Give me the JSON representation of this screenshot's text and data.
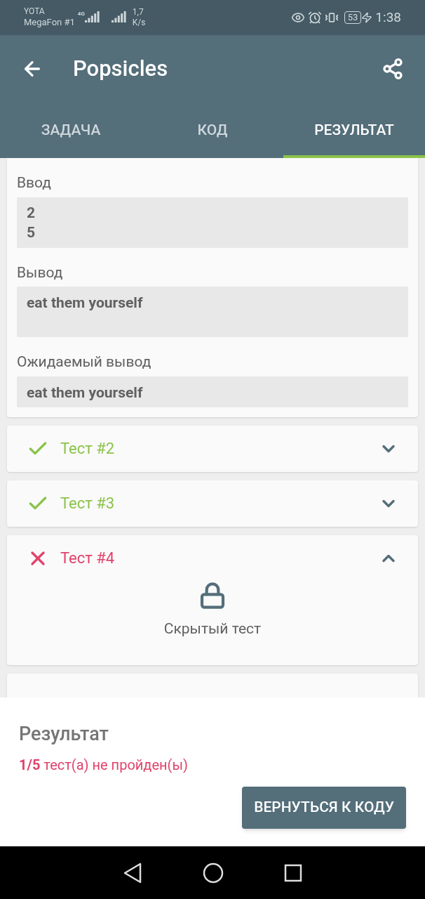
{
  "status_bar": {
    "carrier_1": "YOTA",
    "carrier_2": "MegaFon #1",
    "network": "4G",
    "speed_value": "1,7",
    "speed_unit": "K/s",
    "battery": "53",
    "time": "1:38"
  },
  "app_bar": {
    "title": "Popsicles"
  },
  "tabs": [
    {
      "label": "ЗАДАЧА",
      "selected": false
    },
    {
      "label": "КОД",
      "selected": false
    },
    {
      "label": "РЕЗУЛЬТАТ",
      "selected": true
    }
  ],
  "open_test": {
    "input_label": "Ввод",
    "input_lines": [
      "2",
      "5"
    ],
    "output_label": "Вывод",
    "output": "eat them yourself",
    "expected_label": "Ожидаемый вывод",
    "expected": "eat them yourself"
  },
  "tests": [
    {
      "name": "Тест #2",
      "passed": true,
      "expanded": false
    },
    {
      "name": "Тест #3",
      "passed": true,
      "expanded": false
    },
    {
      "name": "Тест #4",
      "passed": false,
      "expanded": true,
      "hidden_text": "Скрытый тест"
    }
  ],
  "result": {
    "title": "Результат",
    "summary": "**1/5** тест(а) не пройден(ы)",
    "button": "ВЕРНУТЬСЯ К КОДУ"
  }
}
